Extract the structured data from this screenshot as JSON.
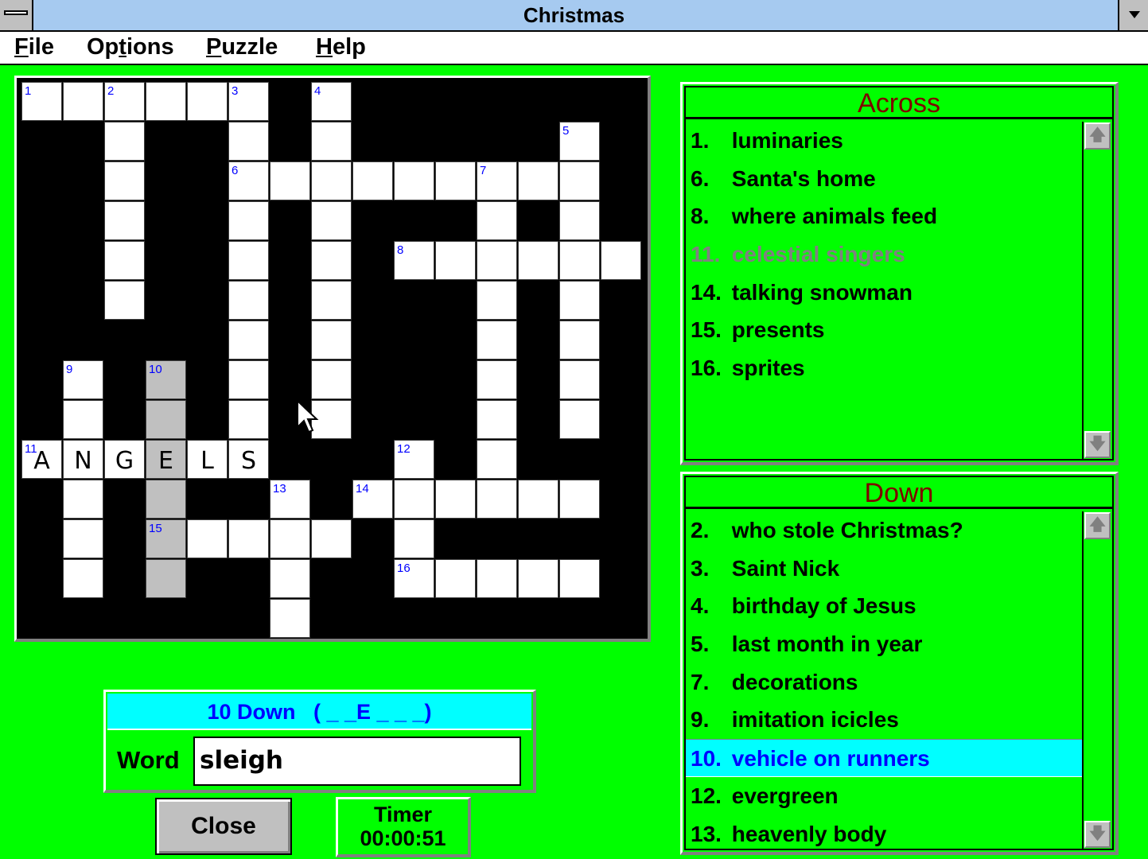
{
  "window": {
    "title": "Christmas"
  },
  "menu": [
    {
      "label": "File",
      "mnemonic": "F"
    },
    {
      "label": "Options",
      "mnemonic": "t"
    },
    {
      "label": "Puzzle",
      "mnemonic": "P"
    },
    {
      "label": "Help",
      "mnemonic": "H"
    }
  ],
  "grid": {
    "rows": 14,
    "cols": 15,
    "cells": [
      {
        "r": 0,
        "c": 0,
        "num": "1"
      },
      {
        "r": 0,
        "c": 1
      },
      {
        "r": 0,
        "c": 2,
        "num": "2"
      },
      {
        "r": 0,
        "c": 3
      },
      {
        "r": 0,
        "c": 4
      },
      {
        "r": 0,
        "c": 5,
        "num": "3"
      },
      {
        "r": 0,
        "c": 7,
        "num": "4"
      },
      {
        "r": 1,
        "c": 2
      },
      {
        "r": 1,
        "c": 5
      },
      {
        "r": 1,
        "c": 7
      },
      {
        "r": 1,
        "c": 13,
        "num": "5"
      },
      {
        "r": 2,
        "c": 2
      },
      {
        "r": 2,
        "c": 5,
        "num": "6"
      },
      {
        "r": 2,
        "c": 6
      },
      {
        "r": 2,
        "c": 7
      },
      {
        "r": 2,
        "c": 8
      },
      {
        "r": 2,
        "c": 9
      },
      {
        "r": 2,
        "c": 10
      },
      {
        "r": 2,
        "c": 11,
        "num": "7"
      },
      {
        "r": 2,
        "c": 12
      },
      {
        "r": 2,
        "c": 13
      },
      {
        "r": 3,
        "c": 2
      },
      {
        "r": 3,
        "c": 5
      },
      {
        "r": 3,
        "c": 7
      },
      {
        "r": 3,
        "c": 11
      },
      {
        "r": 3,
        "c": 13
      },
      {
        "r": 4,
        "c": 2
      },
      {
        "r": 4,
        "c": 5
      },
      {
        "r": 4,
        "c": 7
      },
      {
        "r": 4,
        "c": 9,
        "num": "8"
      },
      {
        "r": 4,
        "c": 10
      },
      {
        "r": 4,
        "c": 11
      },
      {
        "r": 4,
        "c": 12
      },
      {
        "r": 4,
        "c": 13
      },
      {
        "r": 4,
        "c": 14
      },
      {
        "r": 5,
        "c": 2
      },
      {
        "r": 5,
        "c": 5
      },
      {
        "r": 5,
        "c": 7
      },
      {
        "r": 5,
        "c": 11
      },
      {
        "r": 5,
        "c": 13
      },
      {
        "r": 6,
        "c": 5
      },
      {
        "r": 6,
        "c": 7
      },
      {
        "r": 6,
        "c": 11
      },
      {
        "r": 6,
        "c": 13
      },
      {
        "r": 7,
        "c": 1,
        "num": "9"
      },
      {
        "r": 7,
        "c": 3,
        "num": "10",
        "hl": true
      },
      {
        "r": 7,
        "c": 5
      },
      {
        "r": 7,
        "c": 7
      },
      {
        "r": 7,
        "c": 11
      },
      {
        "r": 7,
        "c": 13
      },
      {
        "r": 8,
        "c": 1
      },
      {
        "r": 8,
        "c": 3,
        "hl": true
      },
      {
        "r": 8,
        "c": 5
      },
      {
        "r": 8,
        "c": 7
      },
      {
        "r": 8,
        "c": 11
      },
      {
        "r": 8,
        "c": 13
      },
      {
        "r": 9,
        "c": 0,
        "num": "11",
        "letter": "A"
      },
      {
        "r": 9,
        "c": 1,
        "letter": "N"
      },
      {
        "r": 9,
        "c": 2,
        "letter": "G"
      },
      {
        "r": 9,
        "c": 3,
        "letter": "E",
        "hl": true
      },
      {
        "r": 9,
        "c": 4,
        "letter": "L"
      },
      {
        "r": 9,
        "c": 5,
        "letter": "S"
      },
      {
        "r": 9,
        "c": 9,
        "num": "12"
      },
      {
        "r": 9,
        "c": 11
      },
      {
        "r": 10,
        "c": 1
      },
      {
        "r": 10,
        "c": 3,
        "hl": true
      },
      {
        "r": 10,
        "c": 6,
        "num": "13"
      },
      {
        "r": 10,
        "c": 8,
        "num": "14"
      },
      {
        "r": 10,
        "c": 9
      },
      {
        "r": 10,
        "c": 10
      },
      {
        "r": 10,
        "c": 11
      },
      {
        "r": 10,
        "c": 12
      },
      {
        "r": 10,
        "c": 13
      },
      {
        "r": 11,
        "c": 1
      },
      {
        "r": 11,
        "c": 3,
        "num": "15",
        "hl": true
      },
      {
        "r": 11,
        "c": 4
      },
      {
        "r": 11,
        "c": 5
      },
      {
        "r": 11,
        "c": 6
      },
      {
        "r": 11,
        "c": 7
      },
      {
        "r": 11,
        "c": 9
      },
      {
        "r": 12,
        "c": 1
      },
      {
        "r": 12,
        "c": 3,
        "hl": true
      },
      {
        "r": 12,
        "c": 6
      },
      {
        "r": 12,
        "c": 9,
        "num": "16"
      },
      {
        "r": 12,
        "c": 10
      },
      {
        "r": 12,
        "c": 11
      },
      {
        "r": 12,
        "c": 12
      },
      {
        "r": 12,
        "c": 13
      },
      {
        "r": 13,
        "c": 6
      }
    ]
  },
  "across": {
    "title": "Across",
    "clues": [
      {
        "n": "1.",
        "text": "luminaries"
      },
      {
        "n": "6.",
        "text": "Santa's home"
      },
      {
        "n": "8.",
        "text": "where animals feed"
      },
      {
        "n": "11.",
        "text": "celestial singers",
        "state": "solved"
      },
      {
        "n": "14.",
        "text": "talking snowman"
      },
      {
        "n": "15.",
        "text": "presents"
      },
      {
        "n": "16.",
        "text": "sprites"
      }
    ]
  },
  "down": {
    "title": "Down",
    "clues": [
      {
        "n": "2.",
        "text": "who stole Christmas?"
      },
      {
        "n": "3.",
        "text": "Saint Nick"
      },
      {
        "n": "4.",
        "text": "birthday of Jesus"
      },
      {
        "n": "5.",
        "text": "last month in year"
      },
      {
        "n": "7.",
        "text": "decorations"
      },
      {
        "n": "9.",
        "text": "imitation icicles"
      },
      {
        "n": "10.",
        "text": "vehicle on runners",
        "state": "selected"
      },
      {
        "n": "12.",
        "text": "evergreen"
      },
      {
        "n": "13.",
        "text": "heavenly body"
      }
    ]
  },
  "entry": {
    "heading": "10 Down   ( _ _E _ _ _)",
    "word_label": "Word",
    "word_value": "sleigh"
  },
  "close_label": "Close",
  "timer": {
    "label": "Timer",
    "value": "00:00:51"
  },
  "colors": {
    "background": "#00ff00",
    "highlight": "#00ffff",
    "clue_number": "#0000ff",
    "panel_title": "#800000",
    "title_bar": "#a6caf0"
  }
}
